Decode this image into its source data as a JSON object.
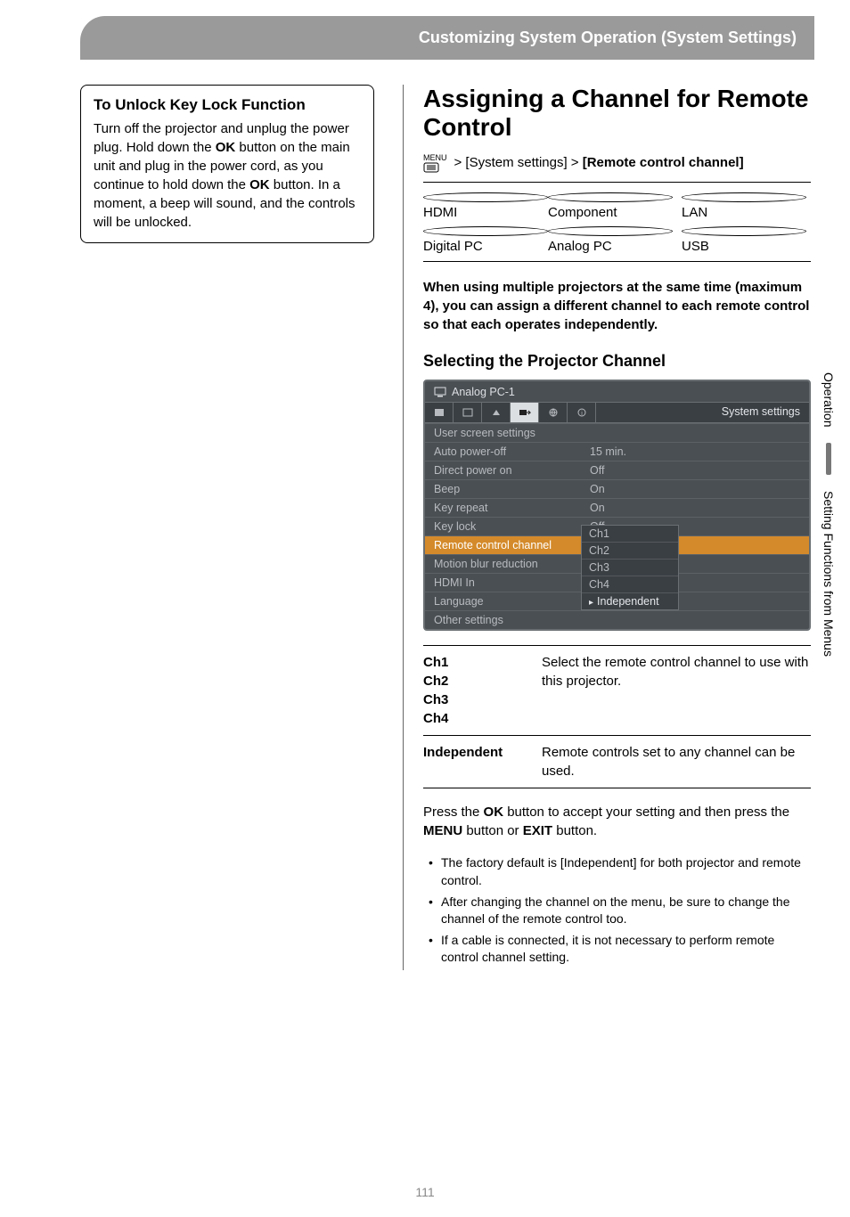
{
  "header": "Customizing System Operation (System Settings)",
  "callout": {
    "title": "To Unlock Key Lock Function",
    "body_parts": [
      "Turn off the projector and unplug the power plug. Hold down the ",
      "OK",
      " button on the main unit and plug in the power cord, as you continue to hold down the ",
      "OK",
      " button. In a moment, a beep will sound, and the controls will be unlocked."
    ]
  },
  "main": {
    "title": "Assigning a Channel for Remote Control",
    "menu_icon_label": "MENU",
    "menu_path_parts": [
      " > [System settings] > ",
      "[Remote control channel]"
    ],
    "inputs": [
      [
        "HDMI",
        "Component",
        "LAN"
      ],
      [
        "Digital PC",
        "Analog PC",
        "USB"
      ]
    ],
    "lead": "When using multiple projectors at the same time (maximum 4), you can assign a different channel to each remote control so that each operates independently.",
    "section_heading": "Selecting the Projector Channel",
    "osd": {
      "source": "Analog PC-1",
      "tabs_label": "System settings",
      "rows": [
        {
          "k": "User screen settings",
          "v": ""
        },
        {
          "k": "Auto power-off",
          "v": "15 min."
        },
        {
          "k": "Direct power on",
          "v": "Off"
        },
        {
          "k": "Beep",
          "v": "On"
        },
        {
          "k": "Key repeat",
          "v": "On"
        },
        {
          "k": "Key lock",
          "v": "Off"
        },
        {
          "k": "Remote control channel",
          "v": "Ch1",
          "hl": true
        },
        {
          "k": "Motion blur reduction",
          "v": ""
        },
        {
          "k": "HDMI In",
          "v": ""
        },
        {
          "k": "Language",
          "v": ""
        },
        {
          "k": "Other settings",
          "v": ""
        }
      ],
      "dropdown": [
        "Ch1",
        "Ch2",
        "Ch3",
        "Ch4",
        "Independent"
      ],
      "dropdown_selected": "Independent"
    },
    "params": [
      {
        "k": "Ch1\nCh2\nCh3\nCh4",
        "v": "Select the remote control channel to use with this projector."
      },
      {
        "k": "Independent",
        "v": "Remote controls set to any channel can be used."
      }
    ],
    "accept_parts": [
      "Press the ",
      "OK",
      " button to accept your setting and then press the ",
      "MENU",
      " button or ",
      "EXIT",
      " button."
    ],
    "notes": [
      "The factory default is [Independent] for both projector and remote control.",
      "After changing the channel on the menu, be sure to change the channel of the remote control too.",
      "If a cable is connected, it is not necessary to perform remote control channel setting."
    ]
  },
  "sidetabs": [
    "Operation",
    "Setting Functions from Menus"
  ],
  "page_number": "111"
}
